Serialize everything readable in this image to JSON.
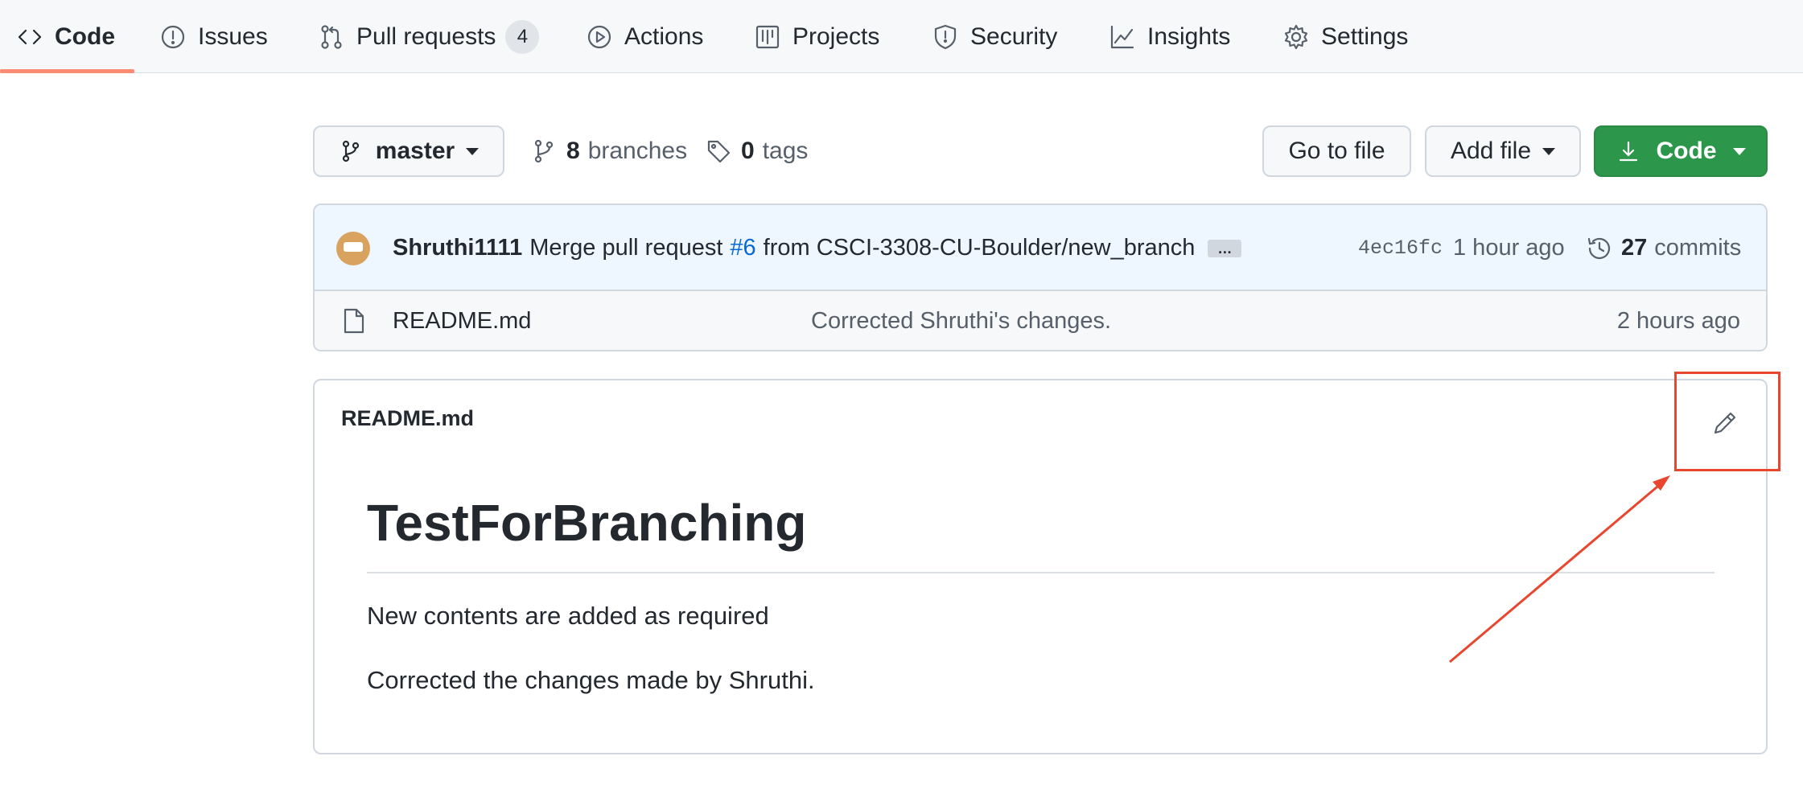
{
  "nav": {
    "items": [
      {
        "label": "Code",
        "icon": "code-icon",
        "selected": true
      },
      {
        "label": "Issues",
        "icon": "issue-icon"
      },
      {
        "label": "Pull requests",
        "icon": "pull-request-icon",
        "count": "4"
      },
      {
        "label": "Actions",
        "icon": "play-icon"
      },
      {
        "label": "Projects",
        "icon": "project-board-icon"
      },
      {
        "label": "Security",
        "icon": "shield-icon"
      },
      {
        "label": "Insights",
        "icon": "graph-icon"
      },
      {
        "label": "Settings",
        "icon": "gear-icon"
      }
    ]
  },
  "toolbar": {
    "branch": "master",
    "branches_count": "8",
    "branches_label": "branches",
    "tags_count": "0",
    "tags_label": "tags",
    "go_to_file": "Go to file",
    "add_file": "Add file",
    "code": "Code"
  },
  "latest_commit": {
    "author": "Shruthi1111",
    "message_prefix": "Merge pull request",
    "pr": "#6",
    "message_suffix": "from CSCI-3308-CU-Boulder/new_branch",
    "ellipsis": "…",
    "sha": "4ec16fc",
    "time": "1 hour ago",
    "commits_count": "27",
    "commits_label": "commits"
  },
  "files": [
    {
      "name": "README.md",
      "message": "Corrected Shruthi's changes.",
      "time": "2 hours ago",
      "icon": "file-icon"
    }
  ],
  "readme": {
    "file_label": "README.md",
    "heading": "TestForBranching",
    "paragraphs": [
      "New contents are added as required",
      "Corrected the changes made by Shruthi."
    ]
  },
  "colors": {
    "accent_underline": "#fd8c73",
    "code_button": "#2c974b",
    "link": "#0969da",
    "annotation": "#e8462f"
  }
}
